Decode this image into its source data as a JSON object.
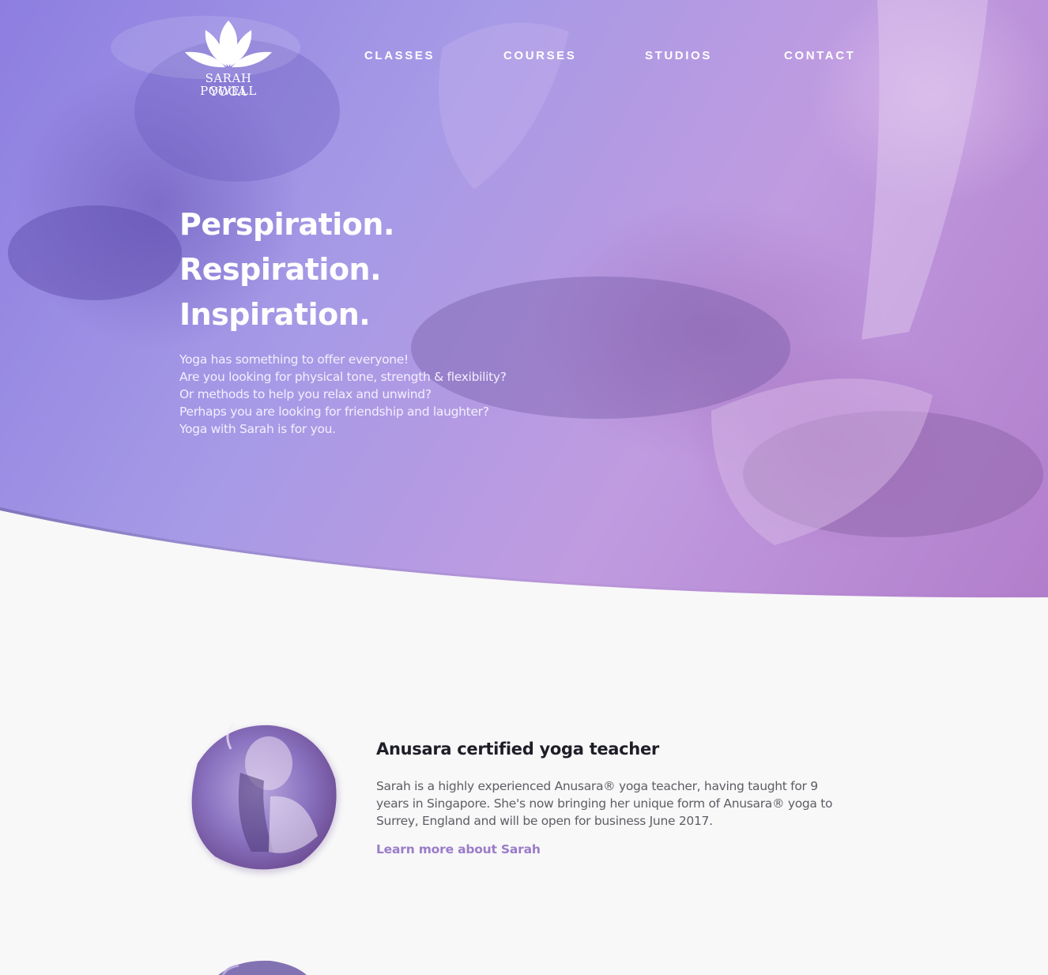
{
  "brand": {
    "line1": "SARAH POWELL",
    "line2": "YOGA",
    "logo_icon": "lotus-icon"
  },
  "nav": {
    "items": [
      {
        "label": "CLASSES"
      },
      {
        "label": "COURSES"
      },
      {
        "label": "STUDIOS"
      },
      {
        "label": "CONTACT"
      }
    ]
  },
  "hero": {
    "headline": [
      "Perspiration.",
      "Respiration.",
      "Inspiration."
    ],
    "intro": [
      "Yoga has something to offer everyone!",
      "Are you looking for physical tone, strength & flexibility?",
      "Or methods to help you relax and unwind?",
      "Perhaps you are looking for friendship and laughter?",
      "Yoga with Sarah is for you."
    ]
  },
  "about": {
    "title": "Anusara certified yoga teacher",
    "text": [
      "Sarah is a highly experienced Anusara® yoga teacher, having taught for 9",
      "years in Singapore. She's now bringing her unique form of Anusara® yoga to",
      "Surrey, England and will be open for business June 2017."
    ],
    "link": "Learn more about Sarah"
  },
  "colors": {
    "hero_purple": "#a69ae6",
    "hero_magenta": "#b27ecb",
    "accent_link": "#9a7cc9",
    "page_background": "#f8f8f8"
  }
}
